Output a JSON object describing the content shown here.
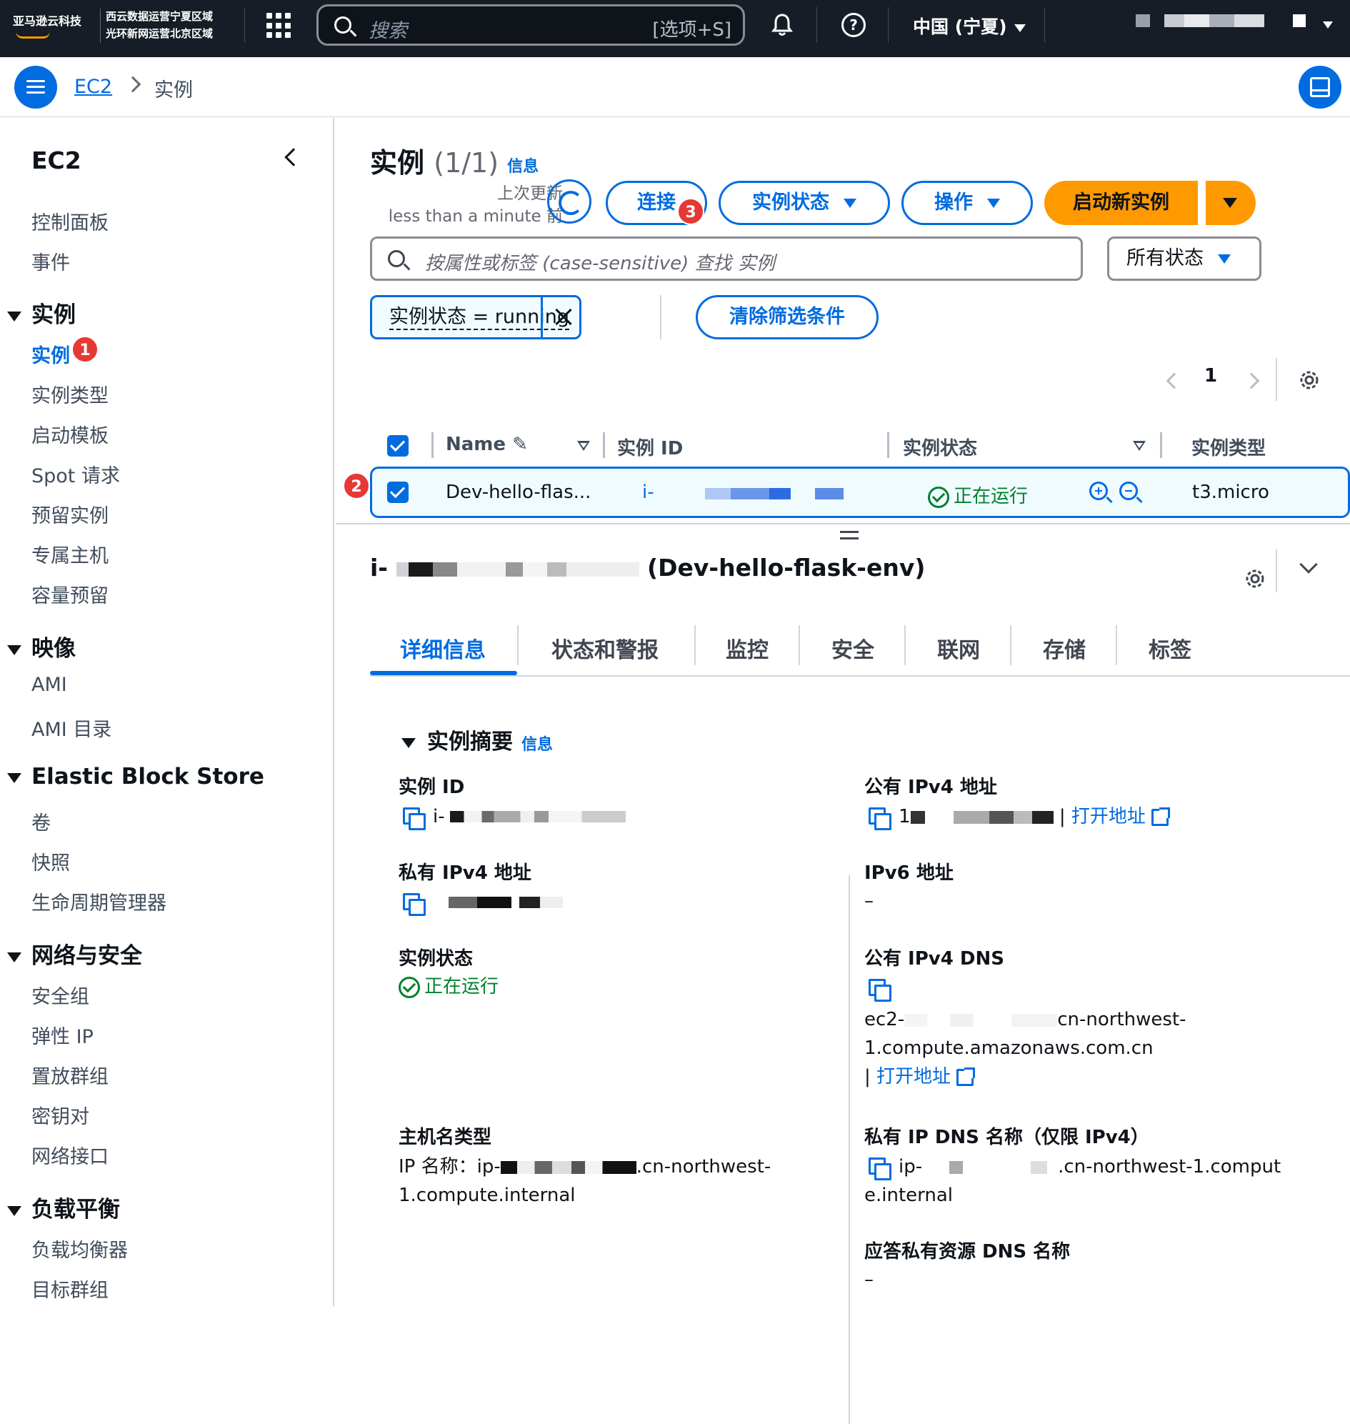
{
  "topbar": {
    "logo_text": "亚马逊云科技",
    "region_note_1": "西云数据运营宁夏区域",
    "region_note_2": "光环新网运营北京区域",
    "search_placeholder": "搜索",
    "search_shortcut": "[选项+S]",
    "region": "中国 (宁夏)"
  },
  "breadcrumb": {
    "service": "EC2",
    "current": "实例"
  },
  "sidebar": {
    "title": "EC2",
    "top_items": [
      "控制面板",
      "事件"
    ],
    "sections": [
      {
        "label": "实例",
        "items": [
          "实例",
          "实例类型",
          "启动模板",
          "Spot 请求",
          "预留实例",
          "专属主机",
          "容量预留"
        ]
      },
      {
        "label": "映像",
        "items": [
          "AMI",
          "AMI 目录"
        ]
      },
      {
        "label": "Elastic Block Store",
        "items": [
          "卷",
          "快照",
          "生命周期管理器"
        ]
      },
      {
        "label": "网络与安全",
        "items": [
          "安全组",
          "弹性 IP",
          "置放群组",
          "密钥对",
          "网络接口"
        ]
      },
      {
        "label": "负载平衡",
        "items": [
          "负载均衡器",
          "目标群组"
        ]
      }
    ],
    "active_item": "实例"
  },
  "annotations": [
    "1",
    "2",
    "3"
  ],
  "main": {
    "title": "实例",
    "count": "(1/1)",
    "info": "信息",
    "last_updated_label": "上次更新",
    "last_updated_value": "less than a minute 前",
    "buttons": {
      "connect": "连接",
      "instance_state": "实例状态",
      "actions": "操作",
      "launch": "启动新实例"
    },
    "filter_placeholder": "按属性或标签 (case-sensitive) 查找 实例",
    "state_select": "所有状态",
    "filter_chip": "实例状态 = running",
    "clear_filters": "清除筛选条件",
    "page": "1",
    "columns": [
      "Name",
      "实例 ID",
      "实例状态",
      "实例类型"
    ],
    "rows": [
      {
        "name": "Dev-hello-flas...",
        "instance_id": "i-",
        "state": "正在运行",
        "type": "t3.micro"
      }
    ]
  },
  "details": {
    "title_prefix": "i-",
    "title_suffix": "(Dev-hello-flask-env)",
    "tabs": [
      "详细信息",
      "状态和警报",
      "监控",
      "安全",
      "联网",
      "存储",
      "标签"
    ],
    "summary_title": "实例摘要",
    "summary_info": "信息",
    "left": {
      "instance_id_label": "实例 ID",
      "instance_id_value": "i-",
      "private_ipv4_label": "私有 IPv4 地址",
      "state_label": "实例状态",
      "state_value": "正在运行",
      "hostname_label": "主机名类型",
      "hostname_line1": "IP 名称：ip-",
      "hostname_line1b": ".cn-northwest-",
      "hostname_line2": "1.compute.internal"
    },
    "right": {
      "public_ipv4_label": "公有 IPv4 地址",
      "public_ipv4_value": "1",
      "open_address": "打开地址",
      "ipv6_label": "IPv6 地址",
      "ipv6_value": "–",
      "public_dns_label": "公有 IPv4 DNS",
      "public_dns_line1a": "ec2-",
      "public_dns_line1b": "cn-northwest-",
      "public_dns_line2": "1.compute.amazonaws.com.cn",
      "private_dns_label": "私有 IP DNS 名称（仅限 IPv4）",
      "private_dns_line1a": "ip-",
      "private_dns_line1b": ".cn-northwest-1.comput",
      "private_dns_line2": "e.internal",
      "answer_dns_label": "应答私有资源 DNS 名称",
      "answer_dns_value": "–"
    }
  }
}
